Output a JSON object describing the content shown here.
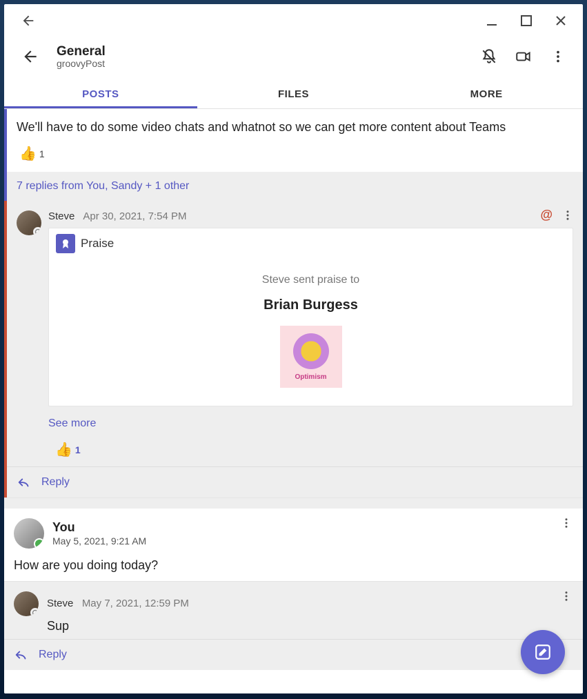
{
  "header": {
    "channel_title": "General",
    "team_name": "groovyPost"
  },
  "tabs": {
    "posts": "POSTS",
    "files": "FILES",
    "more": "MORE",
    "active": "posts"
  },
  "thread1": {
    "post_text": "We'll have to do some video chats and whatnot so we can get more content about Teams",
    "like_count": "1",
    "summary": "7 replies from You, Sandy + 1 other",
    "reply": {
      "author": "Steve",
      "timestamp": "Apr 30, 2021, 7:54 PM",
      "praise_label": "Praise",
      "praise_subtitle": "Steve sent praise to",
      "praise_target": "Brian Burgess",
      "praise_badge_text": "Optimism",
      "see_more": "See more",
      "like_count": "1"
    },
    "reply_action": "Reply"
  },
  "thread2": {
    "author": "You",
    "timestamp": "May 5, 2021, 9:21 AM",
    "text": "How are you doing today?",
    "reply": {
      "author": "Steve",
      "timestamp": "May 7, 2021, 12:59 PM",
      "text": "Sup"
    },
    "reply_action": "Reply"
  }
}
